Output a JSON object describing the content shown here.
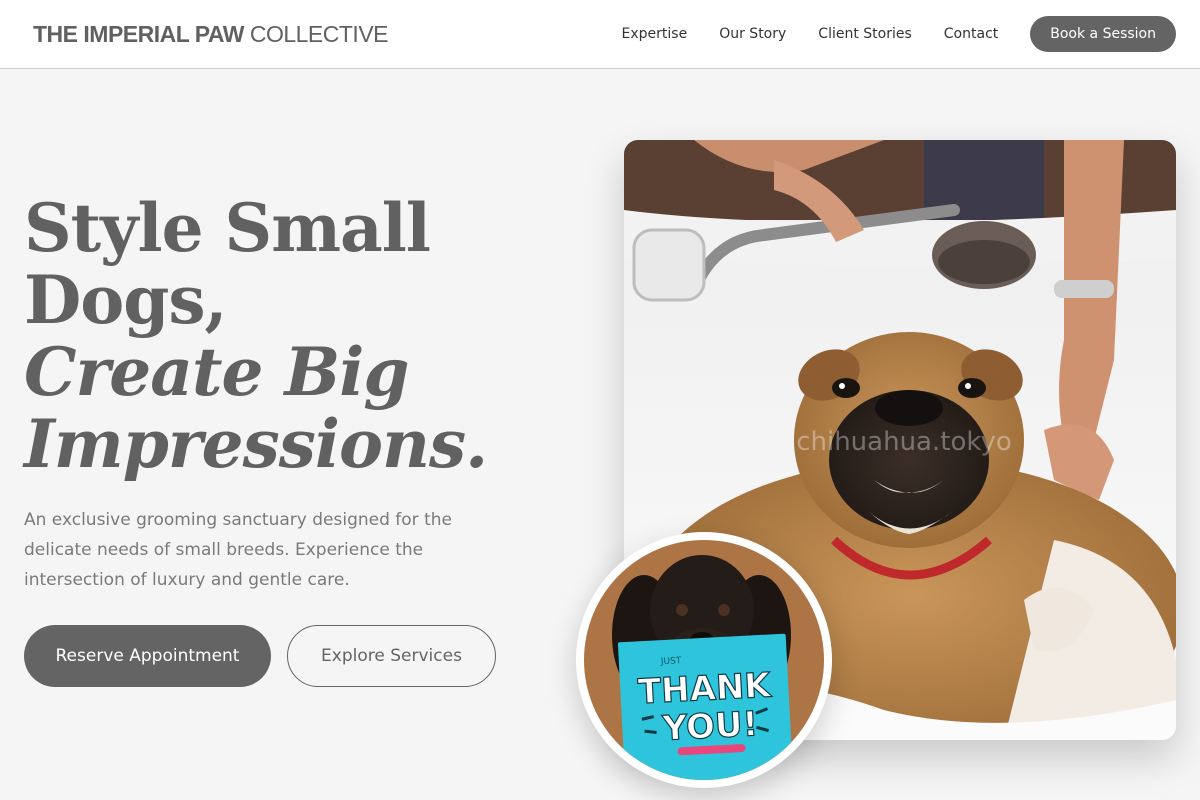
{
  "header": {
    "logo_bold": "THE IMPERIAL PAW",
    "logo_light": "COLLECTIVE",
    "nav": [
      {
        "label": "Expertise"
      },
      {
        "label": "Our Story"
      },
      {
        "label": "Client Stories"
      },
      {
        "label": "Contact"
      }
    ],
    "cta_label": "Book a Session"
  },
  "hero": {
    "title_line1": "Style Small",
    "title_line2": "Dogs,",
    "title_line3": "Create Big",
    "title_line4": "Impressions.",
    "description": "An exclusive grooming sanctuary designed for the delicate needs of small breeds. Experience the intersection of luxury and gentle care.",
    "primary_button": "Reserve Appointment",
    "secondary_button": "Explore Services"
  },
  "images": {
    "main_watermark": "chihuahua.tokyo",
    "inset_card_small": "JUST",
    "inset_card_line1": "THANK",
    "inset_card_line2": "YOU!"
  },
  "colors": {
    "page_bg": "#f5f5f5",
    "accent": "#646464",
    "header_bg": "#ffffff",
    "card_blue": "#2ec4dc",
    "card_pink": "#e8467c"
  }
}
